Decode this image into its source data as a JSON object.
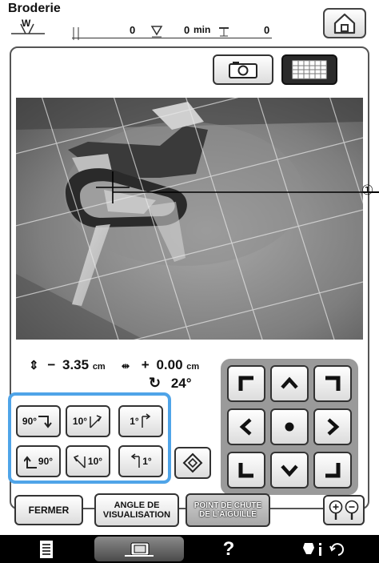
{
  "title": "Broderie",
  "status": {
    "presser_foot_code": "W",
    "stitch_count": "0",
    "time_value": "0",
    "time_unit": "min",
    "color_count": "0"
  },
  "readout": {
    "vertical_sign": "−",
    "vertical_value": "3.35",
    "vertical_unit": "cm",
    "horizontal_sign": "+",
    "horizontal_value": "0.00",
    "horizontal_unit": "cm",
    "rotation_value": "24°"
  },
  "rotate_buttons": {
    "cw_90": "90°",
    "cw_10": "10°",
    "cw_1": "1°",
    "ccw_90": "90°",
    "ccw_10": "10°",
    "ccw_1": "1°"
  },
  "actions": {
    "close": "FERMER",
    "view_angle_line1": "ANGLE DE",
    "view_angle_line2": "VISUALISATION",
    "needle_drop_line1": "POINT DE CHUTE",
    "needle_drop_line2": "DE L'AIGUILLE"
  },
  "callout": "①",
  "icons": [
    "home-icon",
    "camera-icon",
    "grid-icon",
    "arrow-up-icon",
    "arrow-down-icon",
    "arrow-left-icon",
    "arrow-right-icon",
    "center-dot-icon",
    "corner-icon",
    "zoom-in-icon",
    "zoom-out-icon",
    "document-icon",
    "embroidery-frame-icon",
    "help-icon",
    "settings-icon"
  ],
  "colors": {
    "highlight": "#4fa4e8",
    "dark_button": "#1e1e1e",
    "bottom_bar": "#000000"
  }
}
